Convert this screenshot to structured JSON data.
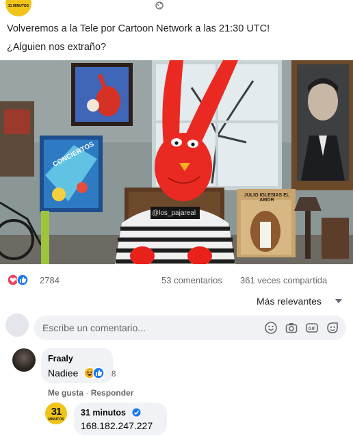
{
  "post": {
    "page_logo_text": "31 MINUTOS",
    "text_line1": "Volveremos a la Tele por Cartoon Network a las 21:30 UTC!",
    "text_line2": "¿Alguien nos extraño?",
    "media": {
      "watermark": "@los_pajareal",
      "poster_text": "JULIO IGLESIAS EL AMOR"
    },
    "reactions": {
      "icons": [
        "love-icon",
        "like-icon"
      ],
      "count": "2784"
    },
    "comments_count": "53 comentarios",
    "shares_count": "361 veces compartida",
    "sort_label": "Más relevantes"
  },
  "composer": {
    "placeholder": "Escribe un comentario...",
    "icons": [
      "emoji-icon",
      "camera-icon",
      "gif-icon",
      "sticker-icon"
    ]
  },
  "comments": [
    {
      "author": "Fraaly",
      "text": "Nadiee",
      "reaction_icons": [
        "haha-icon",
        "like-icon"
      ],
      "reaction_count": "8",
      "actions": {
        "like": "Me gusta",
        "separator": " · ",
        "reply": "Responder"
      }
    }
  ],
  "reply": {
    "logo_main": "31",
    "logo_sub": "MINUTOS",
    "author": "31 minutos",
    "text": "168.182.247.227"
  },
  "colors": {
    "facebook_blue": "#1877f2",
    "love_red": "#f33e58",
    "bubble_bg": "#f0f2f5",
    "secondary_text": "#65676b",
    "brand_yellow": "#f0c419"
  }
}
